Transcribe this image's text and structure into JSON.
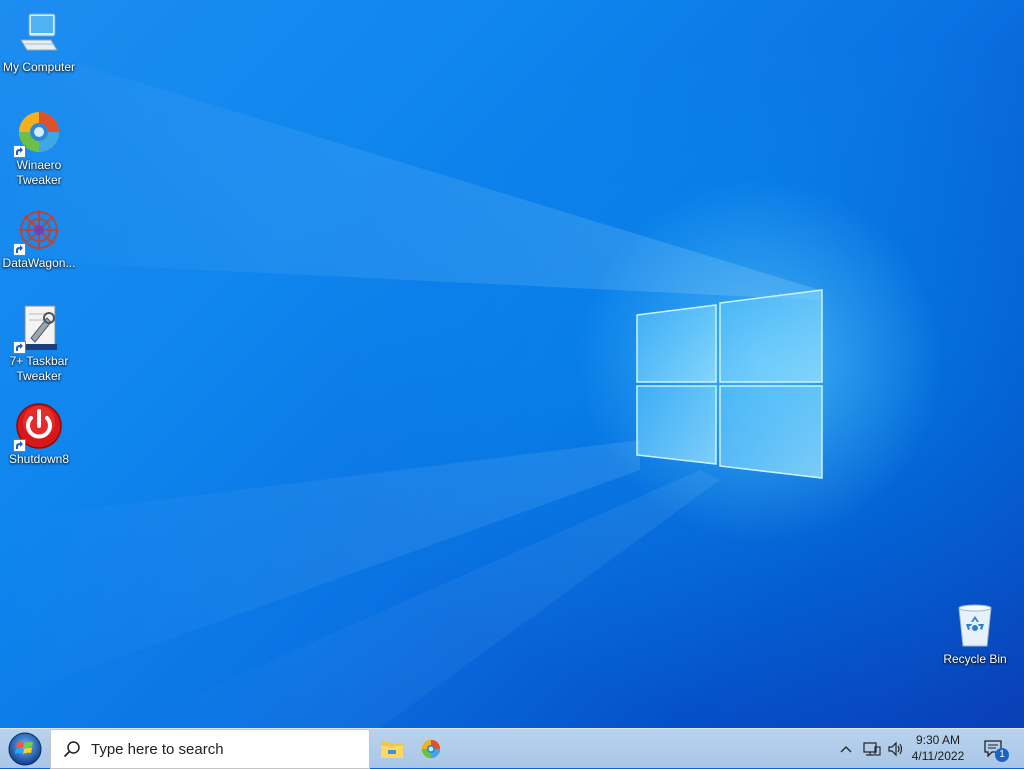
{
  "desktop": {
    "icons": [
      {
        "label": "My Computer",
        "icon": "computer-icon",
        "shortcut": false
      },
      {
        "label": "Winaero Tweaker",
        "icon": "winaero-tweaker-icon",
        "shortcut": true
      },
      {
        "label": "DataWagon...",
        "icon": "datawagon-icon",
        "shortcut": true
      },
      {
        "label": "7+ Taskbar Tweaker",
        "icon": "taskbar-tweaker-icon",
        "shortcut": true
      },
      {
        "label": "Shutdown8",
        "icon": "power-icon",
        "shortcut": true
      },
      {
        "label": "Recycle Bin",
        "icon": "recycle-bin-icon",
        "shortcut": false
      }
    ]
  },
  "taskbar": {
    "search_placeholder": "Type here to search",
    "pinned_apps": [
      "file-explorer-icon",
      "winaero-tweaker-icon"
    ],
    "clock": {
      "time": "9:30 AM",
      "date": "4/11/2022"
    },
    "notifications": {
      "count": "1"
    }
  },
  "colors": {
    "desktop": "#0a6ae0",
    "taskbar": "#b3cdea",
    "accent": "#0078d7"
  }
}
